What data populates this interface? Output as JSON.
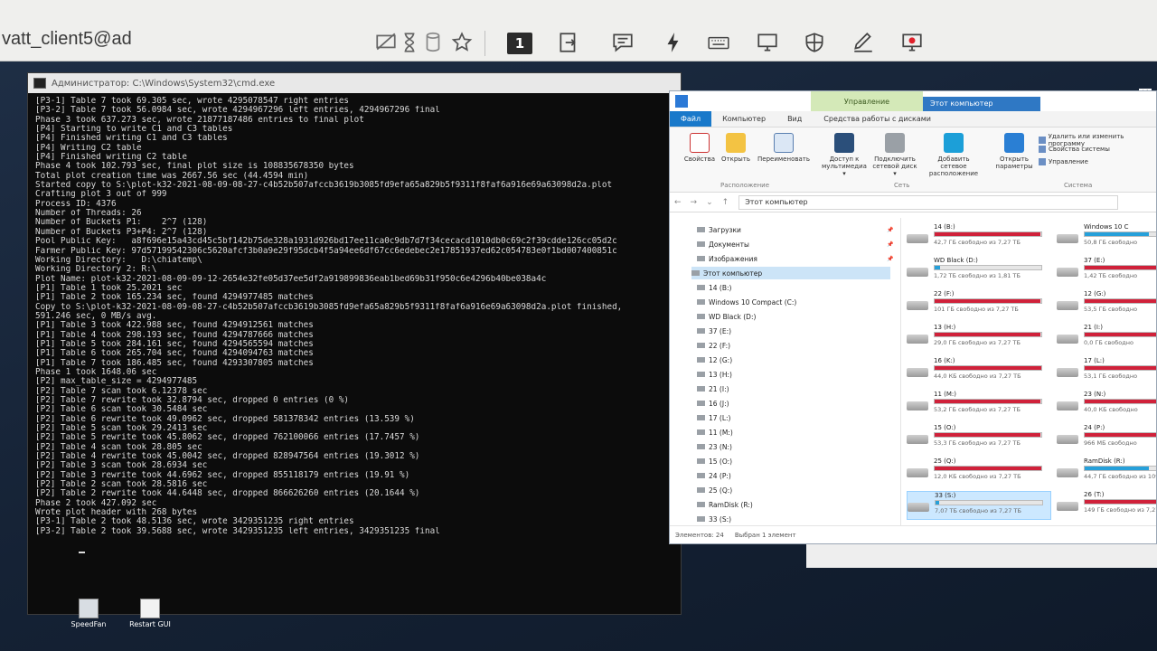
{
  "session": {
    "name": "vatt_client5@ad"
  },
  "toolbar": {
    "monitor_number": "1"
  },
  "console": {
    "title": "Администратор: C:\\Windows\\System32\\cmd.exe",
    "lines": [
      "[P3-1] Table 7 took 69.305 sec, wrote 4295078547 right entries",
      "[P3-2] Table 7 took 56.0984 sec, wrote 4294967296 left entries, 4294967296 final",
      "Phase 3 took 637.273 sec, wrote 21877187486 entries to final plot",
      "[P4] Starting to write C1 and C3 tables",
      "[P4] Finished writing C1 and C3 tables",
      "[P4] Writing C2 table",
      "[P4] Finished writing C2 table",
      "Phase 4 took 102.793 sec, final plot size is 108835678350 bytes",
      "Total plot creation time was 2667.56 sec (44.4594 min)",
      "Started copy to S:\\plot-k32-2021-08-09-08-27-c4b52b507afccb3619b3085fd9efa65a829b5f9311f8faf6a916e69a63098d2a.plot",
      "Crafting plot 3 out of 999",
      "Process ID: 4376",
      "Number of Threads: 26",
      "Number of Buckets P1:    2^7 (128)",
      "Number of Buckets P3+P4: 2^7 (128)",
      "Pool Public Key:   a8f696e15a43cd45c5bf142b75de328a1931d926bd17ee11ca0c9db7d7f34cecacd1010db0c69c2f39cdde126cc05d2c",
      "Farmer Public Key: 97d57199542306c5620afcf3b0a9e29f95dcb4f5a94ee6df67cc6edebec2e17851937ed62c054783e0f1bd007400851c",
      "Working Directory:   D:\\chiatemp\\",
      "Working Directory 2: R:\\",
      "Plot Name: plot-k32-2021-08-09-09-12-2654e32fe05d37ee5df2a919899836eab1bed69b31f950c6e4296b40be038a4c",
      "[P1] Table 1 took 25.2021 sec",
      "[P1] Table 2 took 165.234 sec, found 4294977485 matches",
      "Copy to S:\\plot-k32-2021-08-09-08-27-c4b52b507afccb3619b3085fd9efa65a829b5f9311f8faf6a916e69a63098d2a.plot finished,",
      "591.246 sec, 0 MB/s avg.",
      "[P1] Table 3 took 422.988 sec, found 4294912561 matches",
      "[P1] Table 4 took 298.193 sec, found 4294787666 matches",
      "[P1] Table 5 took 284.161 sec, found 4294565594 matches",
      "[P1] Table 6 took 265.704 sec, found 4294094763 matches",
      "[P1] Table 7 took 186.485 sec, found 4293307805 matches",
      "Phase 1 took 1648.06 sec",
      "[P2] max_table_size = 4294977485",
      "[P2] Table 7 scan took 6.12378 sec",
      "[P2] Table 7 rewrite took 32.8794 sec, dropped 0 entries (0 %)",
      "[P2] Table 6 scan took 30.5484 sec",
      "[P2] Table 6 rewrite took 49.0962 sec, dropped 581378342 entries (13.539 %)",
      "[P2] Table 5 scan took 29.2413 sec",
      "[P2] Table 5 rewrite took 45.8062 sec, dropped 762100066 entries (17.7457 %)",
      "[P2] Table 4 scan took 28.805 sec",
      "[P2] Table 4 rewrite took 45.0042 sec, dropped 828947564 entries (19.3012 %)",
      "[P2] Table 3 scan took 28.6934 sec",
      "[P2] Table 3 rewrite took 44.6962 sec, dropped 855118179 entries (19.91 %)",
      "[P2] Table 2 scan took 28.5816 sec",
      "[P2] Table 2 rewrite took 44.6448 sec, dropped 866626260 entries (20.1644 %)",
      "Phase 2 took 427.092 sec",
      "Wrote plot header with 268 bytes",
      "[P3-1] Table 2 took 48.5136 sec, wrote 3429351235 right entries",
      "[P3-2] Table 2 took 39.5688 sec, wrote 3429351235 left entries, 3429351235 final"
    ]
  },
  "explorer": {
    "manage_label": "Управление",
    "window_title": "Этот компьютер",
    "tabs": [
      "Файл",
      "Компьютер",
      "Вид",
      "Средства работы с дисками"
    ],
    "ribbon": {
      "buttons": [
        "Свойства",
        "Открыть",
        "Переименовать",
        "Доступ к мультимедиа ▾",
        "Подключить сетевой диск ▾",
        "Добавить сетевое расположение",
        "Открыть параметры"
      ],
      "small": [
        "Удалить или изменить программу",
        "Свойства системы",
        "Управление"
      ],
      "groups": [
        "Расположение",
        "Сеть",
        "Система"
      ]
    },
    "address": "Этот компьютер",
    "nav": [
      {
        "label": "Загрузки",
        "pinned": true
      },
      {
        "label": "Документы",
        "pinned": true
      },
      {
        "label": "Изображения",
        "pinned": true
      },
      {
        "label": "Этот компьютер",
        "selected": true
      },
      {
        "label": "14 (B:)"
      },
      {
        "label": "Windows 10 Compact (C:)"
      },
      {
        "label": "WD Black (D:)"
      },
      {
        "label": "37 (E:)"
      },
      {
        "label": "22 (F:)"
      },
      {
        "label": "12 (G:)"
      },
      {
        "label": "13 (H:)"
      },
      {
        "label": "21 (I:)"
      },
      {
        "label": "16 (J:)"
      },
      {
        "label": "17 (L:)"
      },
      {
        "label": "11 (M:)"
      },
      {
        "label": "23 (N:)"
      },
      {
        "label": "15 (O:)"
      },
      {
        "label": "24 (P:)"
      },
      {
        "label": "25 (Q:)"
      },
      {
        "label": "RamDisk (R:)"
      },
      {
        "label": "33 (S:)"
      }
    ],
    "drives_left": [
      {
        "name": "14 (B:)",
        "free": "42,7 ГБ свободно из 7,27 ТБ",
        "used": 0.99
      },
      {
        "name": "WD Black (D:)",
        "free": "1,72 ТБ свободно из 1,81 ТБ",
        "used": 0.05
      },
      {
        "name": "22 (F:)",
        "free": "101 ГБ свободно из 7,27 ТБ",
        "used": 0.99
      },
      {
        "name": "13 (H:)",
        "free": "29,0 ГБ свободно из 7,27 ТБ",
        "used": 0.99
      },
      {
        "name": "16 (K:)",
        "free": "44,0 КБ свободно из 7,27 ТБ",
        "used": 1.0
      },
      {
        "name": "11 (M:)",
        "free": "53,2 ГБ свободно из 7,27 ТБ",
        "used": 0.99
      },
      {
        "name": "15 (O:)",
        "free": "53,3 ГБ свободно из 7,27 ТБ",
        "used": 0.99
      },
      {
        "name": "25 (Q:)",
        "free": "12,0 КБ свободно из 7,27 ТБ",
        "used": 1.0
      },
      {
        "name": "33 (S:)",
        "free": "7,07 ТБ свободно из 7,27 ТБ",
        "used": 0.03,
        "selected": true
      }
    ],
    "drives_right": [
      {
        "name": "Windows 10 C",
        "free": "50,8 ГБ свободно",
        "used": 0.6
      },
      {
        "name": "37 (E:)",
        "free": "1,42 ТБ свободно",
        "used": 0.99
      },
      {
        "name": "12 (G:)",
        "free": "53,5 ГБ свободно",
        "used": 0.99
      },
      {
        "name": "21 (I:)",
        "free": "0,0 ГБ свободно",
        "used": 1.0
      },
      {
        "name": "17 (L:)",
        "free": "53,1 ГБ свободно",
        "used": 0.99
      },
      {
        "name": "23 (N:)",
        "free": "40,0 КБ свободно",
        "used": 1.0
      },
      {
        "name": "24 (P:)",
        "free": "966 МБ свободно",
        "used": 0.99
      },
      {
        "name": "RamDisk (R:)",
        "free": "44,7 ГБ свободно из 109",
        "used": 0.6
      },
      {
        "name": "26 (T:)",
        "free": "149 ГБ свободно из 7,27",
        "used": 0.98
      }
    ],
    "status": [
      "Элементов: 24",
      "Выбран 1 элемент"
    ]
  },
  "desktop_icons": [
    "SpeedFan",
    "Restart GUI"
  ],
  "colors": {
    "console_bg": "#0c0c0c",
    "drive_full": "#d0213a",
    "drive_ok": "#26a0da",
    "file_tab": "#1979ca"
  }
}
